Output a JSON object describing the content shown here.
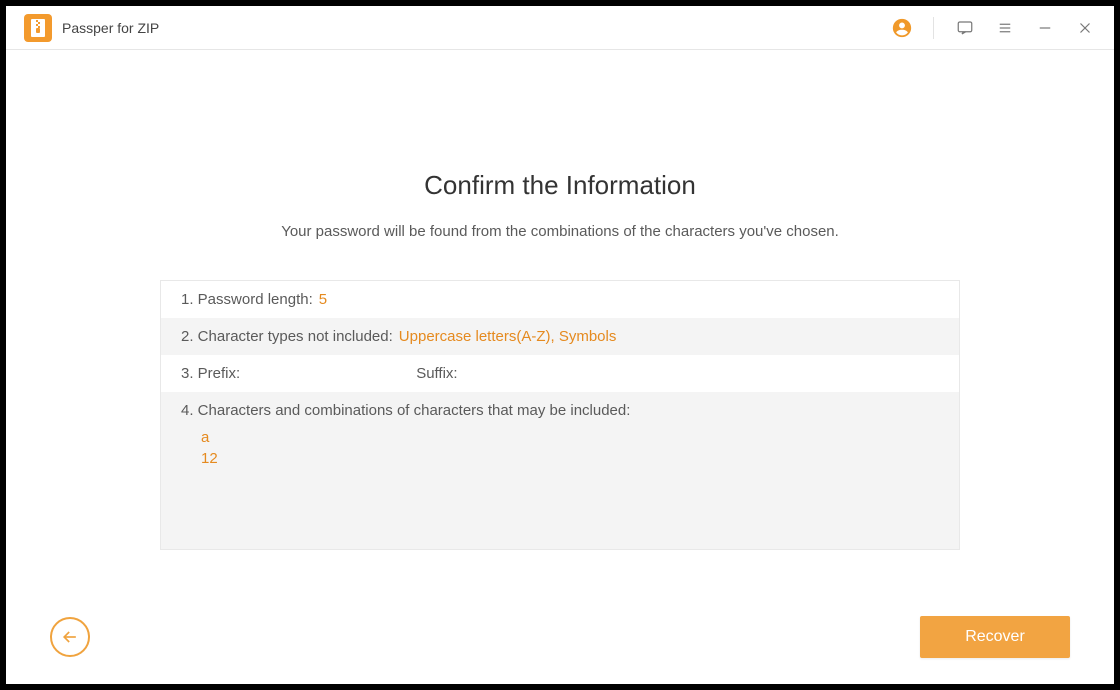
{
  "app": {
    "title": "Passper for ZIP"
  },
  "page": {
    "heading": "Confirm the Information",
    "subheading": "Your password will be found from the combinations of the characters you've chosen."
  },
  "info": {
    "row1_label": "1. Password length: ",
    "row1_value": "5",
    "row2_label": "2. Character types not included: ",
    "row2_value": "Uppercase letters(A-Z), Symbols",
    "row3_prefix_label": "3. Prefix:",
    "row3_suffix_label": "Suffix:",
    "row4_label": "4. Characters and combinations of characters that may be included:",
    "row4_line1": "a",
    "row4_line2": "12"
  },
  "buttons": {
    "recover": "Recover"
  }
}
